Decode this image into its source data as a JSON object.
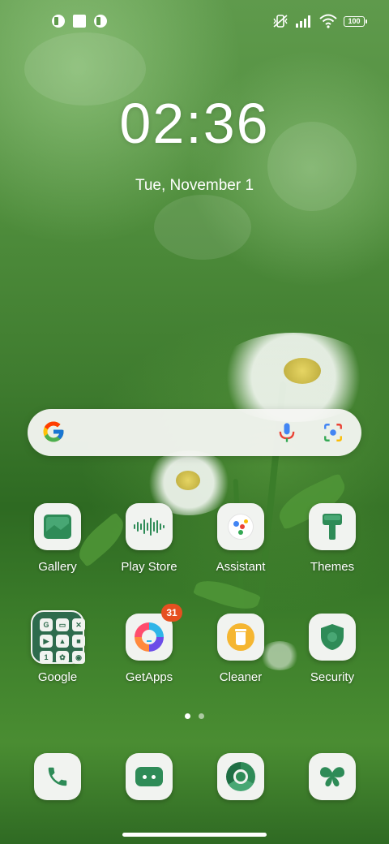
{
  "status_bar": {
    "left_icons": [
      "app-notification-icon",
      "square-notification-icon",
      "app-notification-icon"
    ],
    "right_icons": [
      "vibrate-off-icon",
      "signal-icon",
      "wifi-icon",
      "battery-icon"
    ],
    "battery": "100"
  },
  "clock": {
    "time": "02:36",
    "date": "Tue, November 1"
  },
  "search": {
    "icons": [
      "google-g-icon",
      "mic-icon",
      "lens-icon"
    ]
  },
  "apps": [
    {
      "label": "Gallery",
      "icon": "gallery-icon"
    },
    {
      "label": "Play Store",
      "icon": "soundwave-icon"
    },
    {
      "label": "Assistant",
      "icon": "assistant-icon"
    },
    {
      "label": "Themes",
      "icon": "paintbrush-icon"
    },
    {
      "label": "Google",
      "icon": "folder-icon"
    },
    {
      "label": "GetApps",
      "icon": "getapps-icon",
      "badge": "31"
    },
    {
      "label": "Cleaner",
      "icon": "trash-icon"
    },
    {
      "label": "Security",
      "icon": "shield-icon"
    }
  ],
  "dock": [
    {
      "icon": "phone-icon"
    },
    {
      "icon": "messages-icon"
    },
    {
      "icon": "chrome-icon"
    },
    {
      "icon": "butterfly-icon"
    }
  ],
  "page_indicator": {
    "pages": 2,
    "active": 1
  },
  "colors": {
    "accent_green": "#2e8b57",
    "badge": "#e65020"
  }
}
